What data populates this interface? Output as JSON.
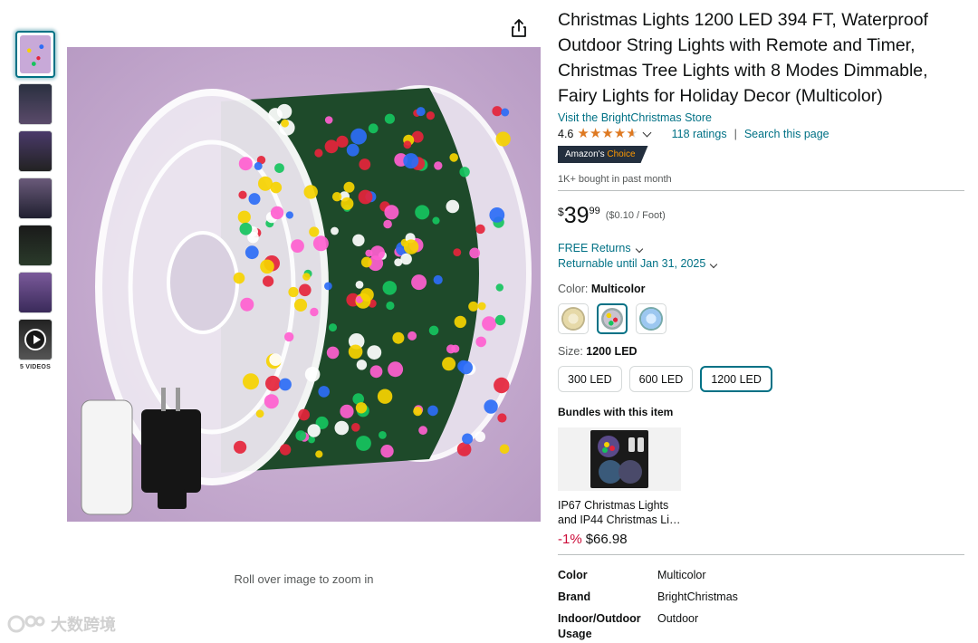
{
  "product": {
    "title": "Christmas Lights 1200 LED 394 FT, Waterproof Outdoor String Lights with Remote and Timer, Christmas Tree Lights with 8 Modes Dimmable, Fairy Lights for Holiday Decor (Multicolor)",
    "store_link": "Visit the BrightChristmas Store",
    "rating": "4.6",
    "rating_stars": 4.6,
    "ratings_count": "118 ratings",
    "search_page": "Search this page",
    "badge_prefix": "Amazon's",
    "badge_suffix": "Choice",
    "bought": "1K+ bought in past month"
  },
  "price": {
    "currency": "$",
    "whole": "39",
    "fraction": "99",
    "unit_price": "($0.10 / Foot)"
  },
  "returns": {
    "free_returns": "FREE Returns",
    "returnable_until": "Returnable until Jan 31, 2025"
  },
  "color": {
    "label": "Color:",
    "selected": "Multicolor",
    "options": [
      "warm-white-swatch",
      "multicolor-swatch",
      "cool-white-swatch"
    ]
  },
  "size": {
    "label": "Size:",
    "selected": "1200 LED",
    "options": [
      "300 LED",
      "600 LED",
      "1200 LED"
    ]
  },
  "bundles": {
    "title": "Bundles with this item",
    "item_name": "IP67 Christmas Lights and IP44 Christmas Li…",
    "discount": "-1%",
    "price": "$66.98"
  },
  "gallery": {
    "videos_label": "5 VIDEOS",
    "zoom_hint": "Roll over image to zoom in"
  },
  "specs": [
    {
      "key": "Color",
      "value": "Multicolor"
    },
    {
      "key": "Brand",
      "value": "BrightChristmas"
    },
    {
      "key": "Indoor/Outdoor Usage",
      "value": "Outdoor"
    }
  ],
  "watermark": "大数跨境",
  "colors": {
    "link": "#007185",
    "star": "#de7921",
    "badge_bg": "#232f3e",
    "badge_accent": "#ff9900",
    "discount": "#cc0c39"
  }
}
